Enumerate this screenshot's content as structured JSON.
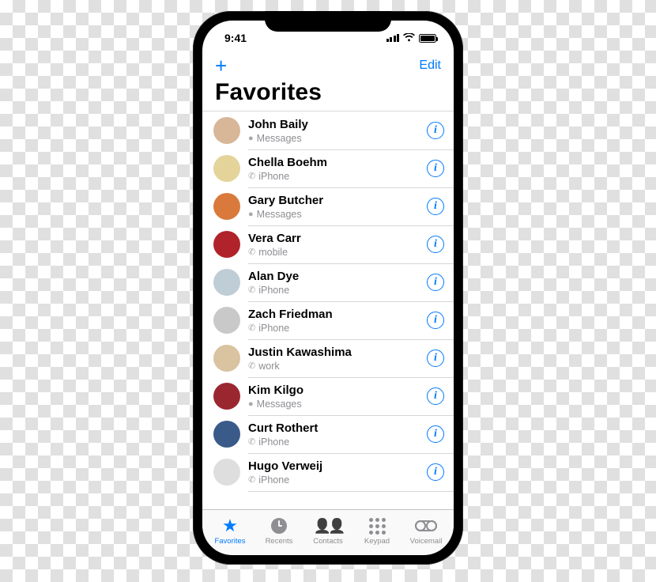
{
  "status": {
    "time": "9:41"
  },
  "nav": {
    "add": "+",
    "edit": "Edit"
  },
  "title": "Favorites",
  "contacts": [
    {
      "name": "John Baily",
      "sub": "Messages",
      "type": "messages",
      "avatar_bg": "#d8b698"
    },
    {
      "name": "Chella Boehm",
      "sub": "iPhone",
      "type": "phone",
      "avatar_bg": "#e4d49a"
    },
    {
      "name": "Gary Butcher",
      "sub": "Messages",
      "type": "messages",
      "avatar_bg": "#d97a3c"
    },
    {
      "name": "Vera Carr",
      "sub": "mobile",
      "type": "phone",
      "avatar_bg": "#b1232a"
    },
    {
      "name": "Alan Dye",
      "sub": "iPhone",
      "type": "phone",
      "avatar_bg": "#bfcdd6"
    },
    {
      "name": "Zach Friedman",
      "sub": "iPhone",
      "type": "phone",
      "avatar_bg": "#c9c9c9"
    },
    {
      "name": "Justin Kawashima",
      "sub": "work",
      "type": "phone",
      "avatar_bg": "#d9c3a0"
    },
    {
      "name": "Kim Kilgo",
      "sub": "Messages",
      "type": "messages",
      "avatar_bg": "#9a2730"
    },
    {
      "name": "Curt Rothert",
      "sub": "iPhone",
      "type": "phone",
      "avatar_bg": "#3a5a8a"
    },
    {
      "name": "Hugo Verweij",
      "sub": "iPhone",
      "type": "phone",
      "avatar_bg": "#dedede"
    }
  ],
  "tabs": [
    {
      "key": "favorites",
      "label": "Favorites",
      "active": true
    },
    {
      "key": "recents",
      "label": "Recents",
      "active": false
    },
    {
      "key": "contacts",
      "label": "Contacts",
      "active": false
    },
    {
      "key": "keypad",
      "label": "Keypad",
      "active": false
    },
    {
      "key": "voicemail",
      "label": "Voicemail",
      "active": false
    }
  ],
  "info_glyph": "i",
  "sub_icons": {
    "messages": "●",
    "phone": "✆"
  }
}
